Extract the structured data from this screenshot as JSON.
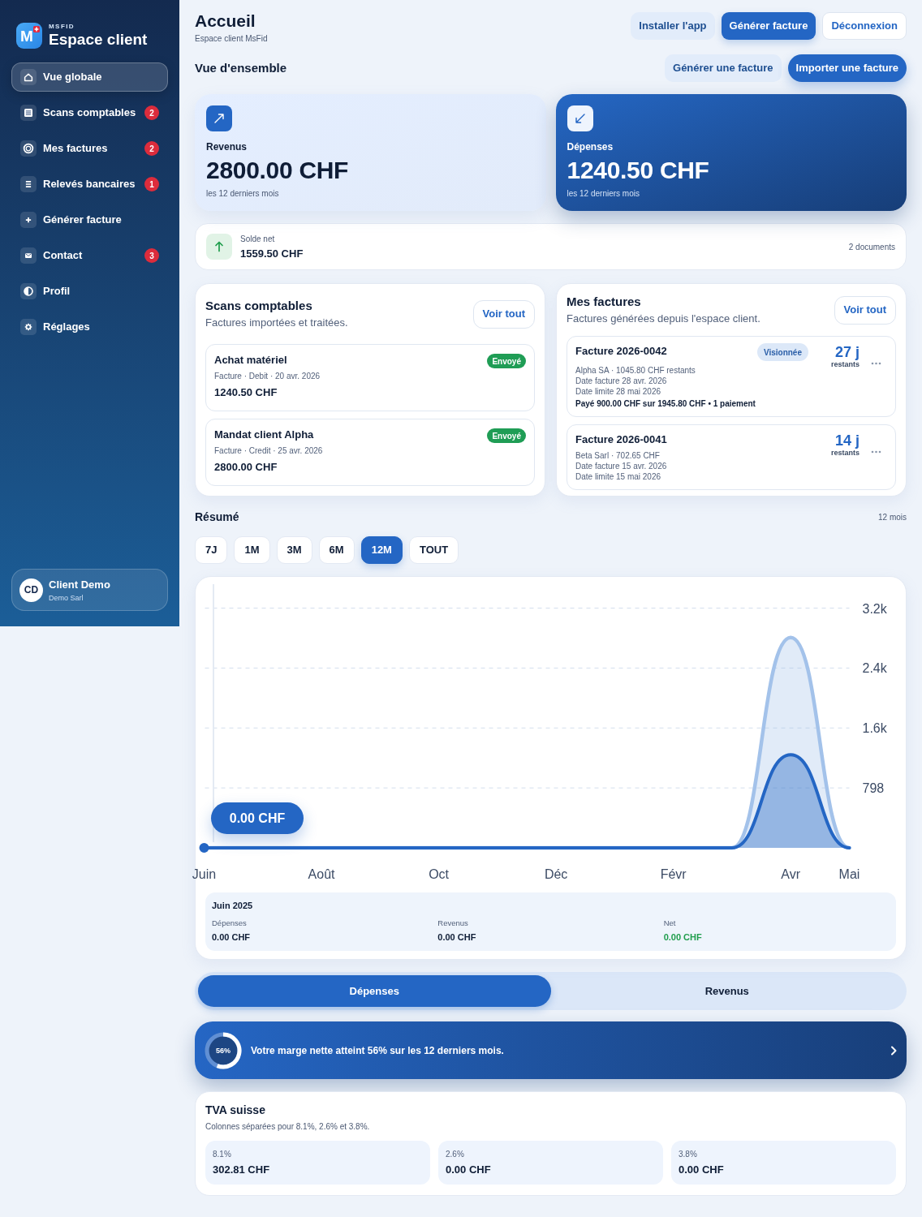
{
  "sidebar": {
    "logo_letter": "M",
    "brand_small": "MSFID",
    "brand": "Espace client",
    "nav": [
      {
        "label": "Vue globale",
        "selected": true
      },
      {
        "label": "Scans comptables",
        "selected": false,
        "badge": "2"
      },
      {
        "label": "Mes factures",
        "selected": false,
        "badge": "2"
      },
      {
        "label": "Relevés bancaires",
        "selected": false,
        "badge": "1"
      },
      {
        "label": "Générer facture",
        "selected": false
      },
      {
        "label": "Contact",
        "selected": false,
        "badge": "3"
      },
      {
        "label": "Profil",
        "selected": false
      },
      {
        "label": "Réglages",
        "selected": false
      }
    ],
    "user": {
      "initials": "CD",
      "name": "Client Demo",
      "company": "Demo Sarl"
    }
  },
  "header": {
    "title": "Accueil",
    "subtitle": "Espace client MsFid",
    "actions": [
      {
        "label": "Installer l'app",
        "kind": "light"
      },
      {
        "label": "Générer facture",
        "kind": "primary"
      },
      {
        "label": "Déconnexion",
        "kind": "outline"
      }
    ]
  },
  "overview": {
    "title": "Vue d'ensemble",
    "actions": [
      {
        "label": "Générer une facture",
        "kind": "light"
      },
      {
        "label": "Importer une facture",
        "kind": "pill"
      }
    ],
    "stats": [
      {
        "kind": "income",
        "label": "Revenus",
        "amount": "2800.00 CHF",
        "period": "les 12 derniers mois"
      },
      {
        "kind": "expense",
        "label": "Dépenses",
        "amount": "1240.50 CHF",
        "period": "les 12 derniers mois"
      }
    ],
    "net": {
      "label": "Solde net",
      "amount": "1559.50 CHF",
      "documents": "2 documents"
    }
  },
  "scans": {
    "title": "Scans comptables",
    "subtitle": "Factures importées et traitées.",
    "link": "Voir tout",
    "items": [
      {
        "title": "Achat matériel",
        "meta": "Facture · Debit · 20 avr. 2026",
        "amount": "1240.50 CHF",
        "status": "Envoyé"
      },
      {
        "title": "Mandat client Alpha",
        "meta": "Facture · Credit · 25 avr. 2026",
        "amount": "2800.00 CHF",
        "status": "Envoyé"
      }
    ]
  },
  "invoices": {
    "title": "Mes factures",
    "subtitle": "Factures générées depuis l'espace client.",
    "link": "Voir tout",
    "items": [
      {
        "title": "Facture 2026-0042",
        "status": "Visionnée",
        "lines": [
          "Alpha SA · 1045.80 CHF restants",
          "Date facture 28 avr. 2026",
          "Date limite 28 mai 2026"
        ],
        "payment": "Payé 900.00 CHF sur 1945.80 CHF • 1 paiement",
        "days": "27 j",
        "days_label": "restants"
      },
      {
        "title": "Facture 2026-0041",
        "lines": [
          "Beta Sarl · 702.65 CHF",
          "Date facture 15 avr. 2026",
          "Date limite 15 mai 2026"
        ],
        "days": "14 j",
        "days_label": "restants"
      }
    ]
  },
  "summary": {
    "title": "Résumé",
    "range_label": "12 mois",
    "ranges": [
      {
        "label": "7J",
        "selected": false
      },
      {
        "label": "1M",
        "selected": false
      },
      {
        "label": "3M",
        "selected": false
      },
      {
        "label": "6M",
        "selected": false
      },
      {
        "label": "12M",
        "selected": true
      },
      {
        "label": "TOUT",
        "selected": false
      }
    ],
    "chart_data": {
      "type": "area",
      "stacked": false,
      "grid": true,
      "categories": [
        "Juin",
        null,
        "Août",
        null,
        "Oct",
        null,
        "Déc",
        null,
        "Févr",
        null,
        "Avr",
        "Mai"
      ],
      "ylim": [
        0,
        3192
      ],
      "yticks": [
        {
          "value": 798,
          "label": "798"
        },
        {
          "value": 1596,
          "label": "1.6k"
        },
        {
          "value": 2394,
          "label": "2.4k"
        },
        {
          "value": 3192,
          "label": "3.2k"
        }
      ],
      "series": [
        {
          "color": "#a3c2ea",
          "values": [
            0,
            0,
            0,
            0,
            0,
            0,
            0,
            0,
            0,
            0,
            2800,
            0
          ]
        },
        {
          "color": "#2466c4",
          "values": [
            0,
            0,
            0,
            0,
            0,
            0,
            0,
            0,
            0,
            0,
            1240,
            0
          ]
        }
      ]
    },
    "tooltip": "0.00 CHF",
    "detail": {
      "title": "Juin 2025",
      "columns": [
        {
          "label": "Dépenses",
          "value": "0.00 CHF",
          "kind": "plain"
        },
        {
          "label": "Revenus",
          "value": "0.00 CHF",
          "kind": "plain"
        },
        {
          "label": "Net",
          "value": "0.00 CHF",
          "kind": "positive"
        }
      ]
    }
  },
  "toggle": [
    {
      "label": "Dépenses",
      "selected": true
    },
    {
      "label": "Revenus",
      "selected": false
    }
  ],
  "banner": {
    "ring_label": "56%",
    "level": 0.56,
    "text": "Votre marge nette atteint 56% sur les 12 derniers mois."
  },
  "vat": {
    "title": "TVA suisse",
    "subtitle": "Colonnes séparées pour 8.1%, 2.6% et 3.8%.",
    "columns": [
      {
        "rate": "8.1%",
        "amount": "302.81 CHF"
      },
      {
        "rate": "2.6%",
        "amount": "0.00 CHF"
      },
      {
        "rate": "3.8%",
        "amount": "0.00 CHF"
      }
    ]
  }
}
